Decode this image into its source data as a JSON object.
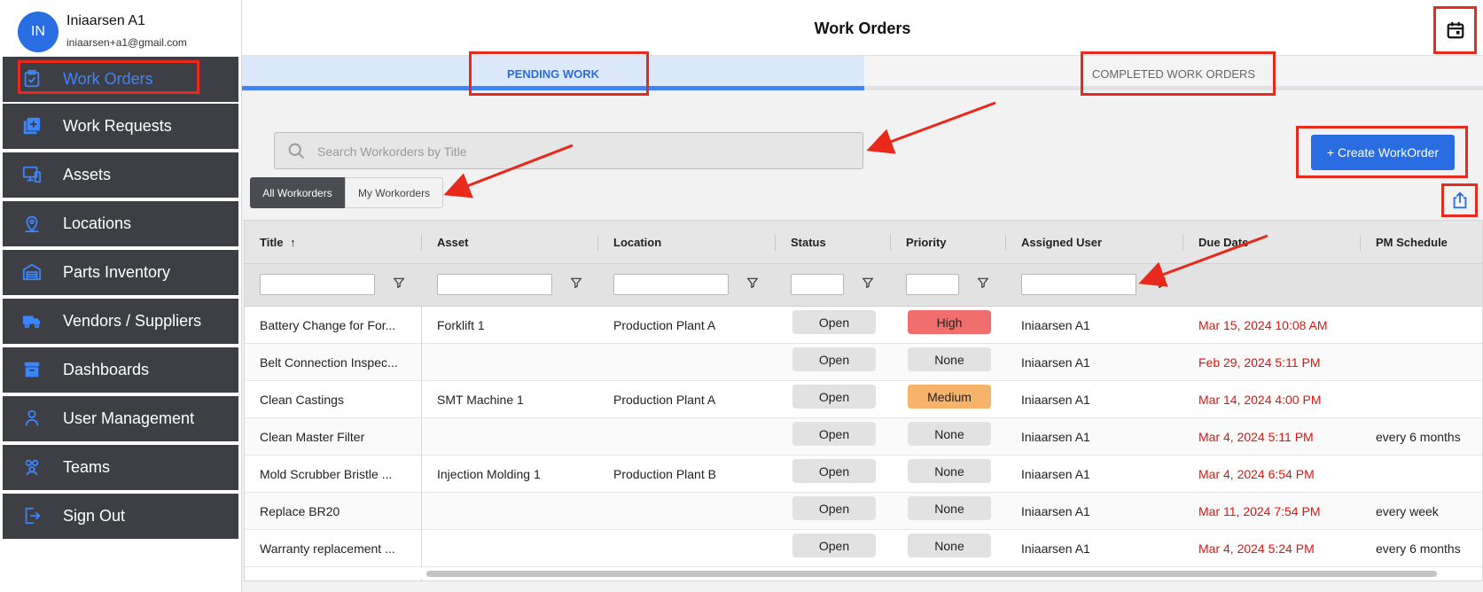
{
  "user": {
    "initials": "IN",
    "name": "Iniaarsen A1",
    "email": "iniaarsen+a1@gmail.com"
  },
  "sidebar": {
    "items": [
      {
        "label": "Work Orders",
        "icon": "clipboard-check-icon"
      },
      {
        "label": "Work Requests",
        "icon": "add-request-icon"
      },
      {
        "label": "Assets",
        "icon": "assets-icon"
      },
      {
        "label": "Locations",
        "icon": "location-pin-icon"
      },
      {
        "label": "Parts Inventory",
        "icon": "warehouse-icon"
      },
      {
        "label": "Vendors / Suppliers",
        "icon": "truck-icon"
      },
      {
        "label": "Dashboards",
        "icon": "archive-box-icon"
      },
      {
        "label": "User Management",
        "icon": "user-icon"
      },
      {
        "label": "Teams",
        "icon": "teams-icon"
      },
      {
        "label": "Sign Out",
        "icon": "sign-out-icon"
      }
    ]
  },
  "header": {
    "title": "Work Orders"
  },
  "tabs": {
    "pending": "PENDING WORK",
    "completed": "COMPLETED WORK ORDERS"
  },
  "search": {
    "placeholder": "Search Workorders by Title"
  },
  "filters": {
    "all": "All Workorders",
    "my": "My Workorders"
  },
  "actions": {
    "create": "+  Create WorkOrder"
  },
  "table": {
    "columns": {
      "title": "Title",
      "asset": "Asset",
      "location": "Location",
      "status": "Status",
      "priority": "Priority",
      "assigned": "Assigned User",
      "due": "Due Date",
      "pm": "PM Schedule"
    },
    "sort_indicator": "↑",
    "rows": [
      {
        "title": "Battery Change for For...",
        "asset": "Forklift 1",
        "location": "Production Plant A",
        "status": "Open",
        "priority": "High",
        "assigned": "Iniaarsen A1",
        "due": "Mar 15, 2024 10:08 AM",
        "pm": ""
      },
      {
        "title": "Belt Connection Inspec...",
        "asset": "",
        "location": "",
        "status": "Open",
        "priority": "None",
        "assigned": "Iniaarsen A1",
        "due": "Feb 29, 2024 5:11 PM",
        "pm": ""
      },
      {
        "title": "Clean Castings",
        "asset": "SMT Machine 1",
        "location": "Production Plant A",
        "status": "Open",
        "priority": "Medium",
        "assigned": "Iniaarsen A1",
        "due": "Mar 14, 2024 4:00 PM",
        "pm": ""
      },
      {
        "title": "Clean Master Filter",
        "asset": "",
        "location": "",
        "status": "Open",
        "priority": "None",
        "assigned": "Iniaarsen A1",
        "due": "Mar 4, 2024 5:11 PM",
        "pm": "every 6 months"
      },
      {
        "title": "Mold Scrubber Bristle ...",
        "asset": "Injection Molding 1",
        "location": "Production Plant B",
        "status": "Open",
        "priority": "None",
        "assigned": "Iniaarsen A1",
        "due": "Mar 4, 2024 6:54 PM",
        "pm": ""
      },
      {
        "title": "Replace BR20",
        "asset": "",
        "location": "",
        "status": "Open",
        "priority": "None",
        "assigned": "Iniaarsen A1",
        "due": "Mar 11, 2024 7:54 PM",
        "pm": "every week"
      },
      {
        "title": "Warranty replacement ...",
        "asset": "",
        "location": "",
        "status": "Open",
        "priority": "None",
        "assigned": "Iniaarsen A1",
        "due": "Mar 4, 2024 5:24 PM",
        "pm": "every 6 months"
      }
    ]
  },
  "colors": {
    "accent": "#2a6de2",
    "sidebar_bg": "#3e3f45",
    "annotation": "#e8291c",
    "priority_high": "#f16e6e",
    "priority_medium": "#f8b36b",
    "priority_none": "#e2e2e2",
    "due_date": "#e0140e"
  }
}
